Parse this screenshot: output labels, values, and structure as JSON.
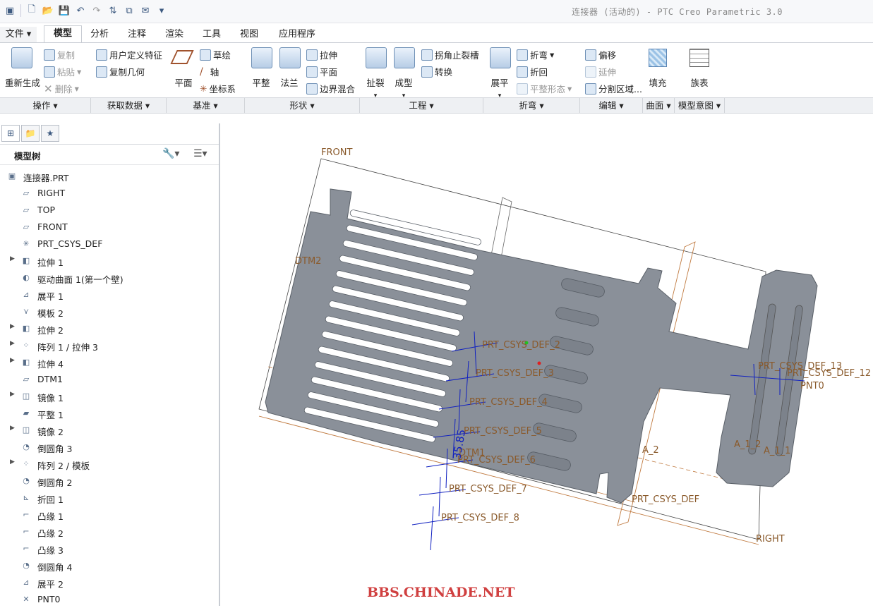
{
  "window": {
    "title": "连接器 (活动的) - PTC Creo Parametric 3.0"
  },
  "menu_tabs": [
    {
      "label": "文件"
    },
    {
      "label": "模型"
    },
    {
      "label": "分析"
    },
    {
      "label": "注释"
    },
    {
      "label": "渲染"
    },
    {
      "label": "工具"
    },
    {
      "label": "视图"
    },
    {
      "label": "应用程序"
    }
  ],
  "ribbon": {
    "regenerate": "重新生成",
    "copy": "复制",
    "paste": "粘贴",
    "delete": "删除",
    "user_feature": "用户定义特征",
    "copy_geometry": "复制几何",
    "plane": "平面",
    "sketch": "草绘",
    "axis": "轴",
    "csys": "坐标系",
    "planar": "平整",
    "flange": "法兰",
    "extrude": "拉伸",
    "flat": "平面",
    "boundary_blend": "边界混合",
    "rip": "扯裂",
    "form": "成型",
    "corner_relief": "拐角止裂槽",
    "convert": "转换",
    "unbend": "展平",
    "bend": "折弯",
    "bend_back": "折回",
    "flat_pattern": "平整形态",
    "offset": "偏移",
    "extend": "延伸",
    "split_area": "分割区域...",
    "fill": "填充",
    "family_table": "族表"
  },
  "ribbon_groups": [
    {
      "label": "操作"
    },
    {
      "label": "获取数据"
    },
    {
      "label": "基准"
    },
    {
      "label": "形状"
    },
    {
      "label": "工程"
    },
    {
      "label": "折弯"
    },
    {
      "label": "编辑"
    },
    {
      "label": "曲面"
    },
    {
      "label": "模型意图"
    }
  ],
  "model_tree": {
    "title": "模型树",
    "items": [
      {
        "label": "连接器.PRT",
        "icon": "part-icon",
        "expandable": false,
        "root": true
      },
      {
        "label": "RIGHT",
        "icon": "datum-plane-icon",
        "expandable": false
      },
      {
        "label": "TOP",
        "icon": "datum-plane-icon",
        "expandable": false
      },
      {
        "label": "FRONT",
        "icon": "datum-plane-icon",
        "expandable": false
      },
      {
        "label": "PRT_CSYS_DEF",
        "icon": "csys-icon",
        "expandable": false
      },
      {
        "label": "拉伸 1",
        "icon": "extrude-icon",
        "expandable": true
      },
      {
        "label": "驱动曲面 1(第一个壁)",
        "icon": "surface-icon",
        "expandable": false
      },
      {
        "label": "展平 1",
        "icon": "unbend-icon",
        "expandable": false
      },
      {
        "label": "模板 2",
        "icon": "form-icon",
        "expandable": false
      },
      {
        "label": "拉伸 2",
        "icon": "extrude-icon",
        "expandable": true
      },
      {
        "label": "阵列 1 / 拉伸 3",
        "icon": "pattern-icon",
        "expandable": true
      },
      {
        "label": "拉伸 4",
        "icon": "extrude-icon",
        "expandable": true
      },
      {
        "label": "DTM1",
        "icon": "datum-plane-icon",
        "expandable": false
      },
      {
        "label": "镜像 1",
        "icon": "mirror-icon",
        "expandable": true
      },
      {
        "label": "平整 1",
        "icon": "planar-icon",
        "expandable": false
      },
      {
        "label": "镜像 2",
        "icon": "mirror-icon",
        "expandable": true
      },
      {
        "label": "倒圆角 3",
        "icon": "round-icon",
        "expandable": false
      },
      {
        "label": "阵列 2 / 模板",
        "icon": "pattern-icon",
        "expandable": true
      },
      {
        "label": "倒圆角 2",
        "icon": "round-icon",
        "expandable": false
      },
      {
        "label": "折回 1",
        "icon": "bend-back-icon",
        "expandable": false
      },
      {
        "label": "凸缘 1",
        "icon": "flange-icon",
        "expandable": false
      },
      {
        "label": "凸缘 2",
        "icon": "flange-icon",
        "expandable": false
      },
      {
        "label": "凸缘 3",
        "icon": "flange-icon",
        "expandable": false
      },
      {
        "label": "倒圆角 4",
        "icon": "round-icon",
        "expandable": false
      },
      {
        "label": "展平 2",
        "icon": "unbend-icon",
        "expandable": false
      },
      {
        "label": "PNT0",
        "icon": "point-icon",
        "expandable": false
      }
    ]
  },
  "viewport": {
    "labels": {
      "front": "FRONT",
      "dtm2": "DTM2",
      "right": "RIGHT",
      "csys_def": "PRT_CSYS_DEF",
      "csys_def_2": "PRT_CSYS_DEF_2",
      "csys_def_3": "PRT_CSYS_DEF_3",
      "csys_def_4": "PRT_CSYS_DEF_4",
      "csys_def_5": "PRT_CSYS_DEF_5",
      "csys_def_6": "PRT_CSYS_DEF_6",
      "csys_def_7": "PRT_CSYS_DEF_7",
      "csys_def_8": "PRT_CSYS_DEF_8",
      "csys_def_12": "PRT_CSYS_DEF_12",
      "csys_def_13": "PRT_CSYS_DEF_13",
      "pnt0": "PNT0",
      "axis_a2": "A_2",
      "axis_a11": "A_1_1",
      "axis_a12": "A_1_2",
      "dtm1": "DTM1",
      "dim": "35.85"
    },
    "watermark": "BBS.CHINADE.NET",
    "colors": {
      "part": "#8a9099",
      "datum": "#8a5a2b",
      "csys": "#1020c0"
    }
  }
}
